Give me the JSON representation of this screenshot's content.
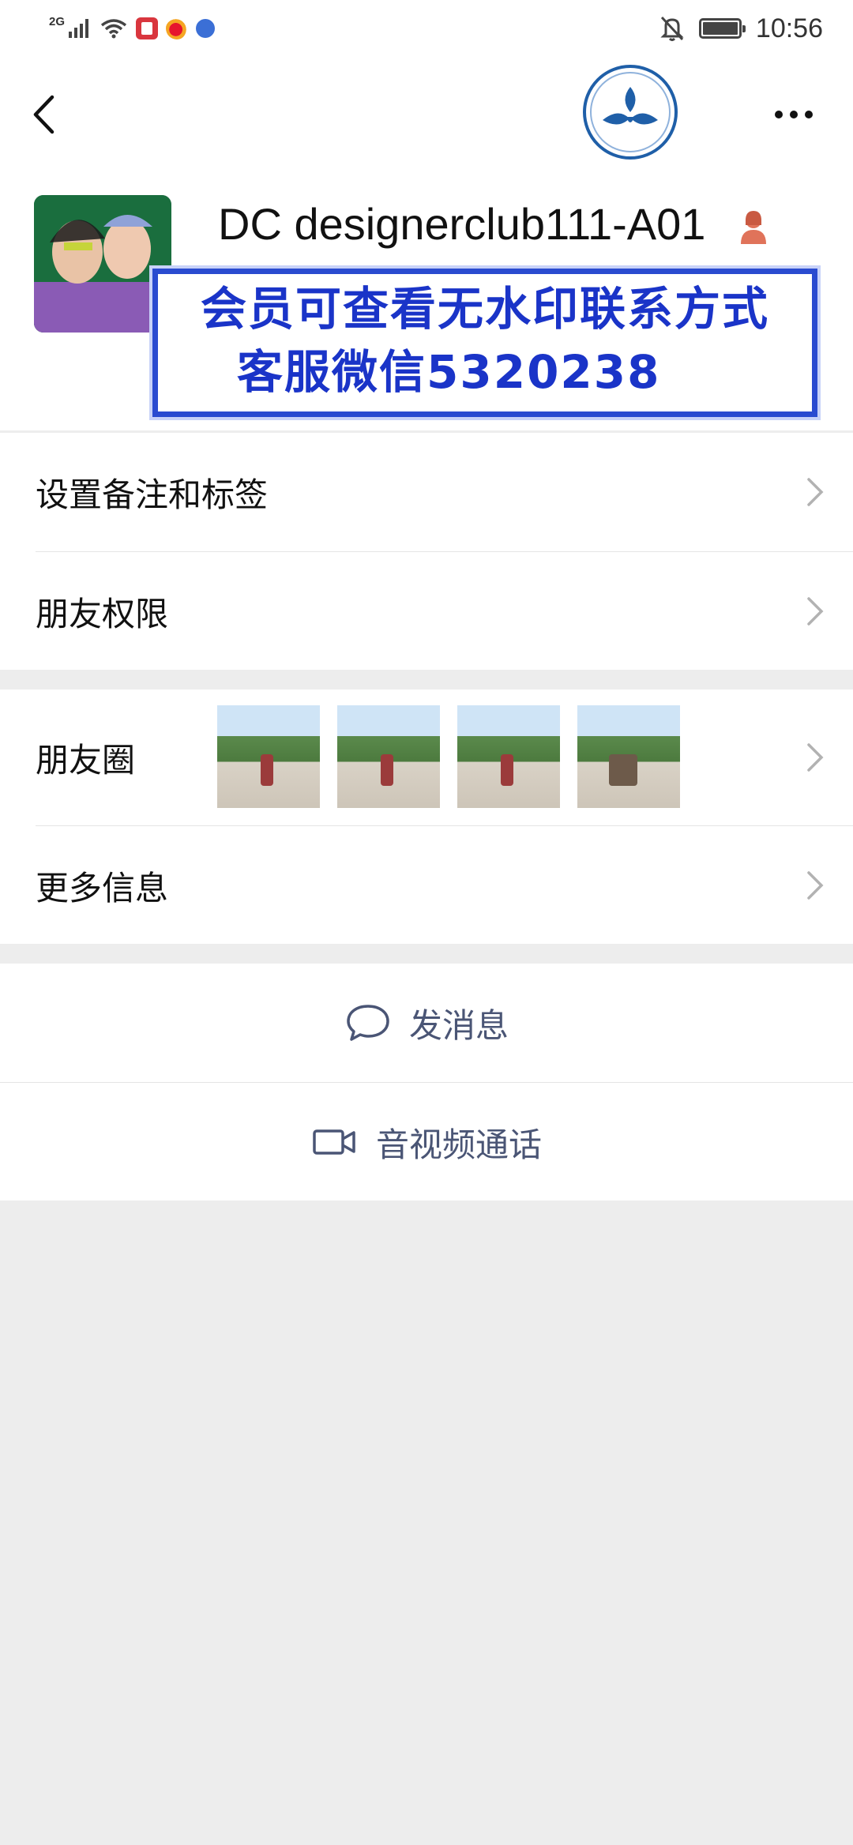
{
  "status_bar": {
    "network": "2G",
    "time": "10:56",
    "icons": [
      "signal-icon",
      "wifi-icon",
      "app-notification-icon",
      "weibo-icon",
      "browser-icon",
      "mute-icon",
      "battery-icon"
    ]
  },
  "header": {
    "back_icon": "back-arrow-icon",
    "logo_icon": "brand-logo-icon",
    "more_icon": "more-dots-icon"
  },
  "profile": {
    "name": "DC designerclub111-A01",
    "gender_icon": "female-icon"
  },
  "watermark": {
    "line1": "会员可查看无水印联系方式",
    "line2": "客服微信5320238"
  },
  "menu": {
    "remark_tags": "设置备注和标签",
    "friend_permissions": "朋友权限",
    "moments": "朋友圈",
    "more_info": "更多信息"
  },
  "actions": {
    "send_message": "发消息",
    "video_call": "音视频通话"
  },
  "colors": {
    "watermark_blue": "#1a34c8",
    "action_text": "#4a5575",
    "background": "#ededed"
  }
}
